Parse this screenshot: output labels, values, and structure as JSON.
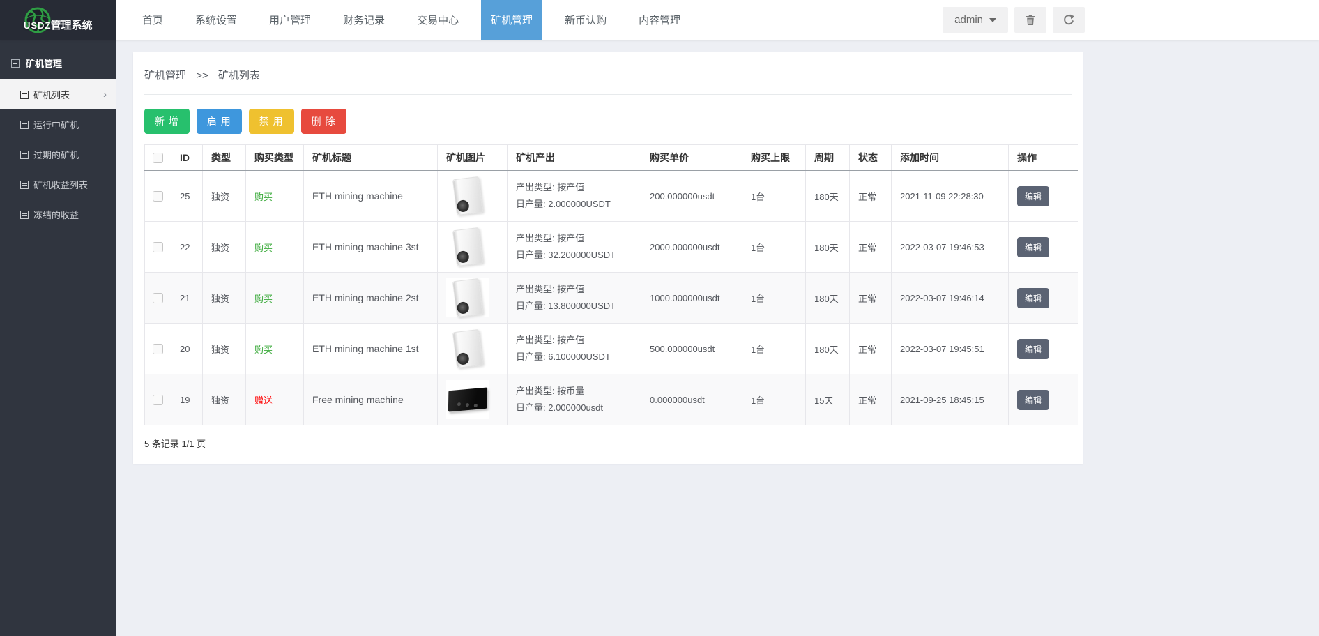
{
  "navbar": {
    "logo_text": "USDZ",
    "logo_suffix": "管理系统",
    "items": [
      {
        "label": "首页",
        "name": "home",
        "active": false
      },
      {
        "label": "系统设置",
        "name": "system-settings",
        "active": false
      },
      {
        "label": "用户管理",
        "name": "user-management",
        "active": false
      },
      {
        "label": "财务记录",
        "name": "finance-records",
        "active": false
      },
      {
        "label": "交易中心",
        "name": "trade-center",
        "active": false
      },
      {
        "label": "矿机管理",
        "name": "miner-management",
        "active": true
      },
      {
        "label": "新币认购",
        "name": "new-coin-subscription",
        "active": false
      },
      {
        "label": "内容管理",
        "name": "content-management",
        "active": false
      }
    ],
    "active_color": "#57a0d9",
    "user_label": "admin"
  },
  "sidebar": {
    "section": "矿机管理",
    "items": [
      {
        "label": "矿机列表",
        "name": "miner-list",
        "active": true
      },
      {
        "label": "运行中矿机",
        "name": "running-miners",
        "active": false
      },
      {
        "label": "过期的矿机",
        "name": "expired-miners",
        "active": false
      },
      {
        "label": "矿机收益列表",
        "name": "miner-income-list",
        "active": false
      },
      {
        "label": "冻结的收益",
        "name": "frozen-income",
        "active": false
      }
    ]
  },
  "main": {
    "breadcrumb": {
      "parent": "矿机管理",
      "separator": ">>",
      "current": "矿机列表"
    },
    "toolbar": [
      {
        "label": "新 增",
        "name": "add-button",
        "color": "#27c06d"
      },
      {
        "label": "启 用",
        "name": "enable-button",
        "color": "#3e97dd"
      },
      {
        "label": "禁 用",
        "name": "disable-button",
        "color": "#efc12f"
      },
      {
        "label": "删 除",
        "name": "delete-button",
        "color": "#e74a3e"
      }
    ],
    "table": {
      "headers": [
        "ID",
        "类型",
        "购买类型",
        "矿机标题",
        "矿机图片",
        "矿机产出",
        "购买单价",
        "购买上限",
        "周期",
        "状态",
        "添加时间",
        "操作"
      ],
      "edit_label": "编辑",
      "buy_type_colors": {
        "购买": "#3aaa3a",
        "赠送": "#ff0000"
      },
      "rows": [
        {
          "id": "25",
          "type": "独资",
          "buy_type": "购买",
          "title": "ETH mining machine",
          "image": "eth-miner",
          "output_type": "产出类型: 按产值",
          "daily_output": "日产量: 2.000000USDT",
          "price": "200.000000usdt",
          "limit": "1台",
          "period": "180天",
          "status": "正常",
          "added": "2021-11-09 22:28:30"
        },
        {
          "id": "22",
          "type": "独资",
          "buy_type": "购买",
          "title": "ETH mining machine 3st",
          "image": "eth-miner",
          "output_type": "产出类型: 按产值",
          "daily_output": "日产量: 32.200000USDT",
          "price": "2000.000000usdt",
          "limit": "1台",
          "period": "180天",
          "status": "正常",
          "added": "2022-03-07 19:46:53"
        },
        {
          "id": "21",
          "type": "独资",
          "buy_type": "购买",
          "title": "ETH mining machine 2st",
          "image": "eth-miner",
          "output_type": "产出类型: 按产值",
          "daily_output": "日产量: 13.800000USDT",
          "price": "1000.000000usdt",
          "limit": "1台",
          "period": "180天",
          "status": "正常",
          "added": "2022-03-07 19:46:14"
        },
        {
          "id": "20",
          "type": "独资",
          "buy_type": "购买",
          "title": "ETH mining machine 1st",
          "image": "eth-miner",
          "output_type": "产出类型: 按产值",
          "daily_output": "日产量: 6.100000USDT",
          "price": "500.000000usdt",
          "limit": "1台",
          "period": "180天",
          "status": "正常",
          "added": "2022-03-07 19:45:51"
        },
        {
          "id": "19",
          "type": "独资",
          "buy_type": "赠送",
          "title": "Free mining machine",
          "image": "black-box",
          "output_type": "产出类型: 按币量",
          "daily_output": "日产量: 2.000000usdt",
          "price": "0.000000usdt",
          "limit": "1台",
          "period": "15天",
          "status": "正常",
          "added": "2021-09-25 18:45:15"
        }
      ]
    },
    "footer": {
      "summary": "5 条记录 1/1 页"
    }
  }
}
